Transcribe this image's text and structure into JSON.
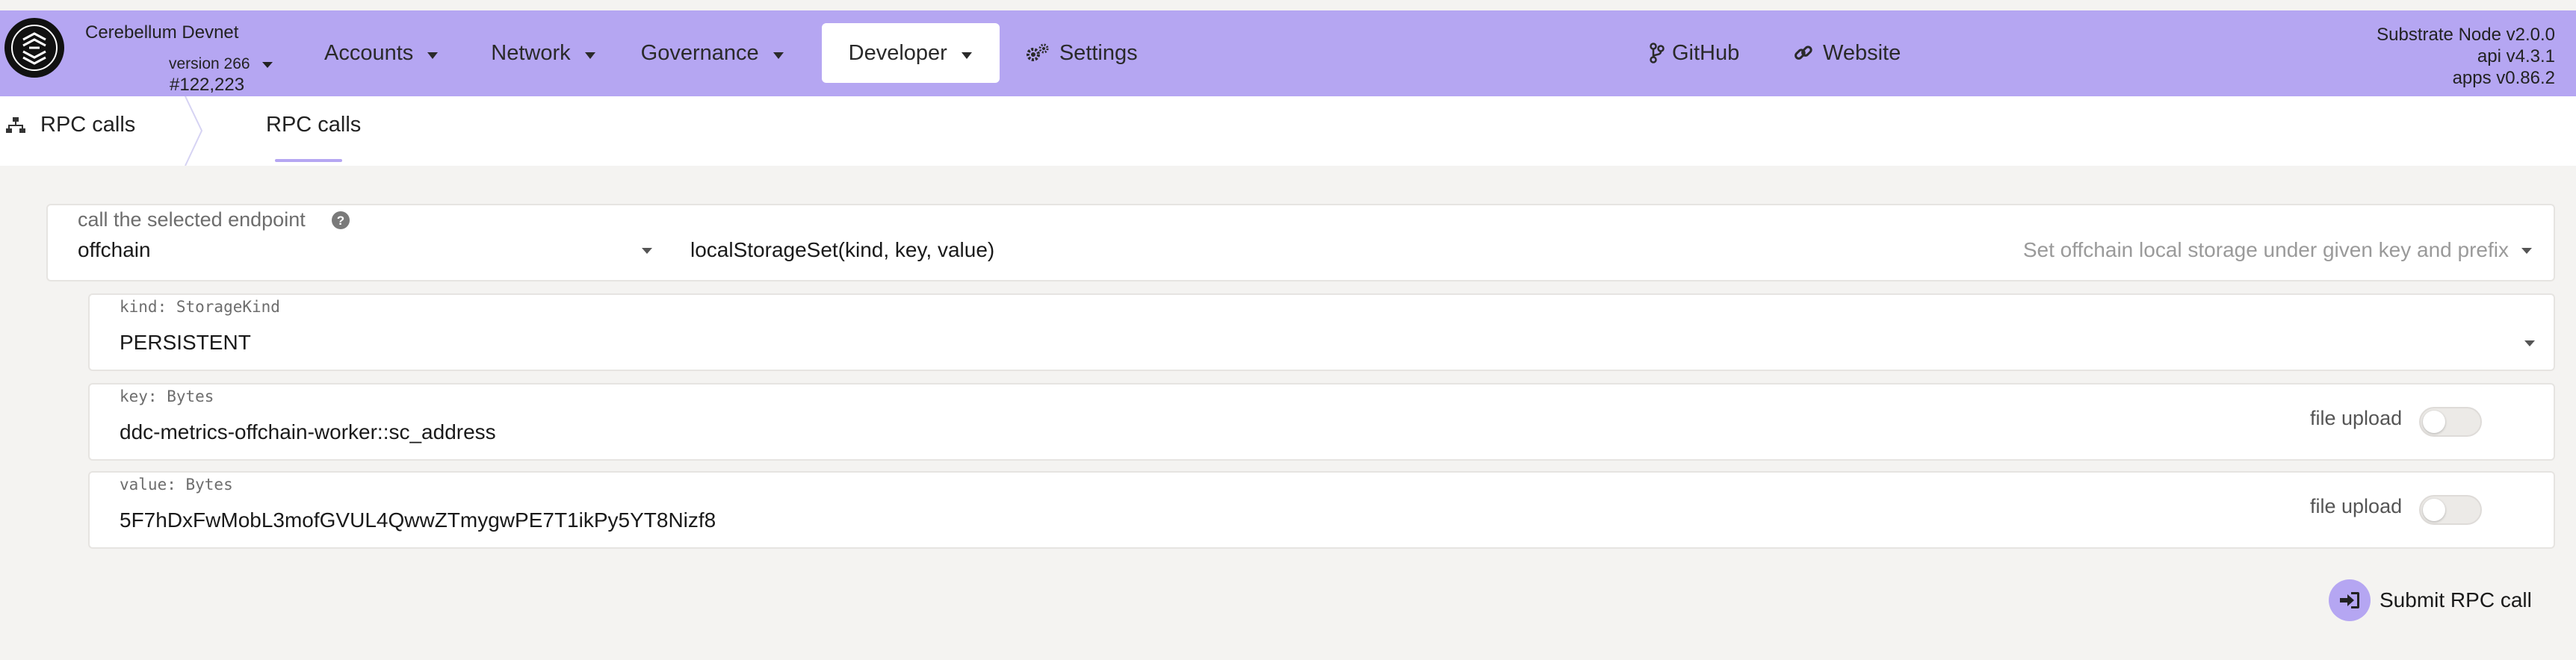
{
  "chain": {
    "name": "Cerebellum Devnet",
    "version": "version 266",
    "block": "#122,223"
  },
  "menu": {
    "accounts": "Accounts",
    "network": "Network",
    "governance": "Governance",
    "developer": "Developer",
    "settings": "Settings"
  },
  "links": {
    "github": "GitHub",
    "website": "Website"
  },
  "node": {
    "name": "Substrate Node v2.0.0",
    "api": "api v4.3.1",
    "apps": "apps v0.86.2"
  },
  "tabs": {
    "section": "RPC calls",
    "active": "RPC calls"
  },
  "endpoint": {
    "label": "call the selected endpoint",
    "section": "offchain",
    "method": "localStorageSet(kind, key, value)",
    "description": "Set offchain local storage under given key and prefix"
  },
  "params": [
    {
      "label": "kind: StorageKind",
      "value": "PERSISTENT"
    },
    {
      "label": "key: Bytes",
      "value": "ddc-metrics-offchain-worker::sc_address",
      "upload_label": "file upload",
      "upload_on": false
    },
    {
      "label": "value: Bytes",
      "value": "5F7hDxFwMobL3mofGVUL4QwwZTmygwPE7T1ikPy5YT8Nizf8",
      "upload_label": "file upload",
      "upload_on": false
    }
  ],
  "submit": {
    "label": "Submit RPC call"
  },
  "colors": {
    "accent": "#b5a6f2",
    "background": "#f4f3f1"
  }
}
